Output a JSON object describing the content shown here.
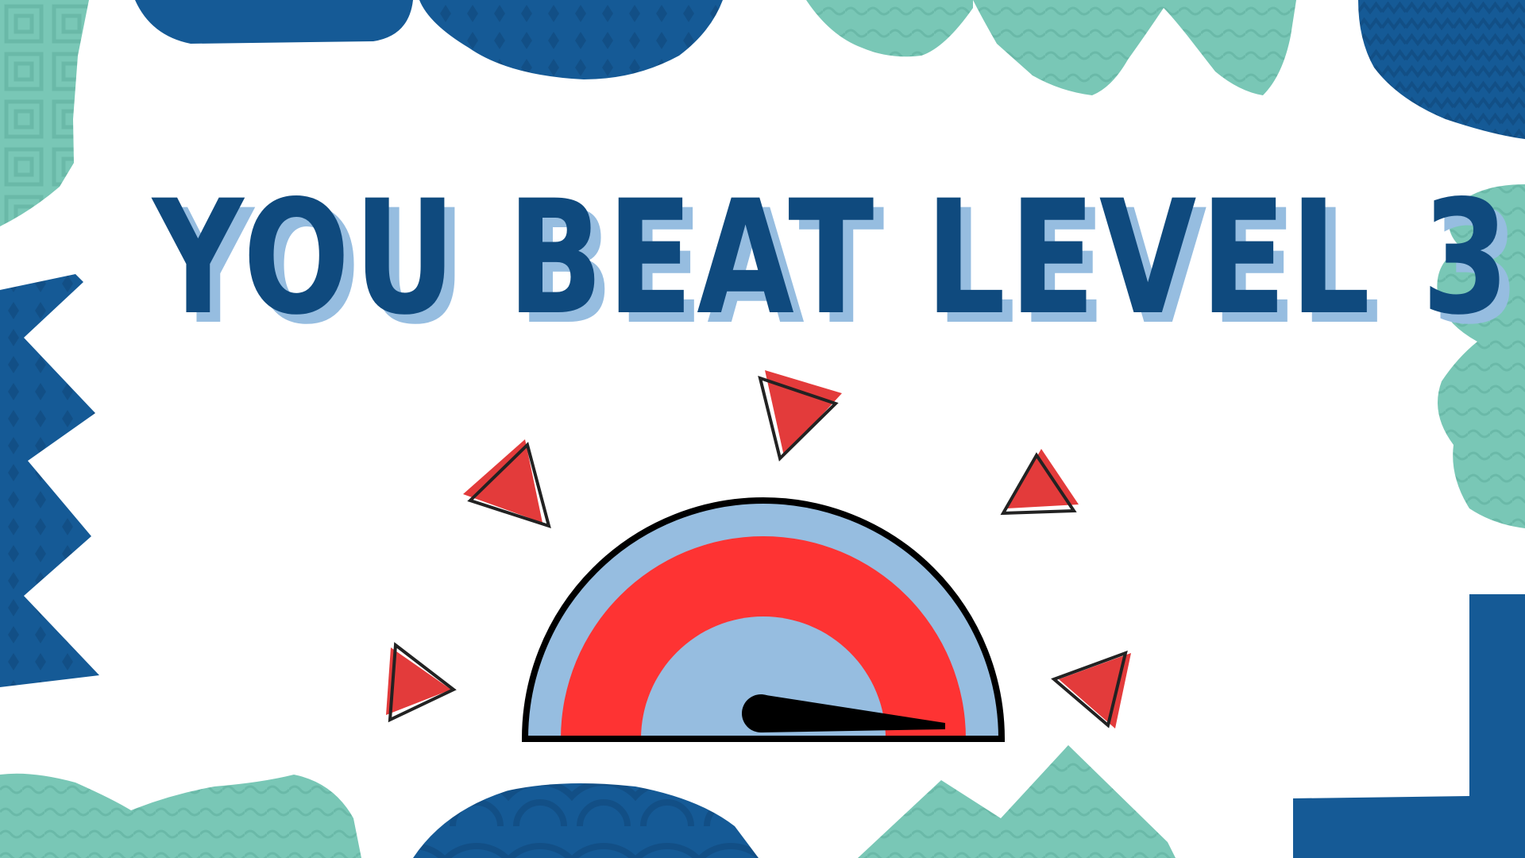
{
  "screen": {
    "title": "YOU BEAT LEVEL 3!",
    "level": 3
  },
  "gauge": {
    "meter_level": 0.97,
    "needle_icon": "speedometer-needle-icon"
  },
  "colors": {
    "title": "#0f4a7e",
    "title_shadow": "#96bde0",
    "navy": "#155a96",
    "teal": "#79c7b6",
    "gauge_red": "#fe3333",
    "gauge_light_blue": "#96bde0",
    "arrow_red": "#e33b3b"
  },
  "icons": {
    "burst_arrows": "arrow-icon",
    "gauge": "speedometer-icon"
  }
}
